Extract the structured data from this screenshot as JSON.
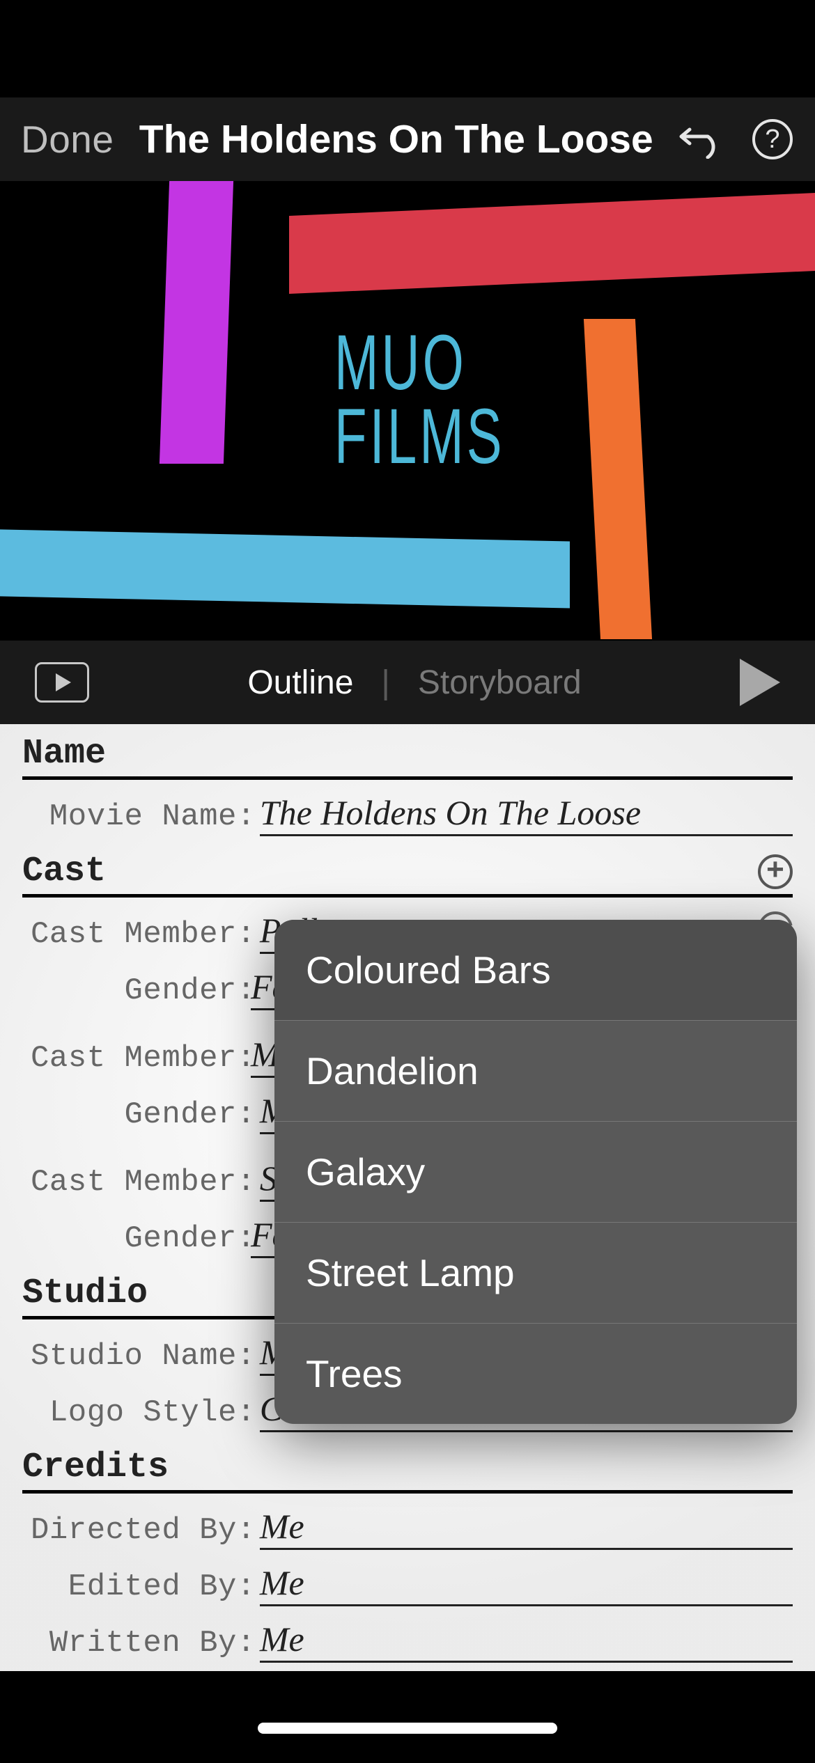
{
  "nav": {
    "done": "Done",
    "title": "The Holdens On The Loose"
  },
  "logo": {
    "line1": "MUO",
    "line2": "FILMS"
  },
  "tabs": {
    "outline": "Outline",
    "storyboard": "Storyboard"
  },
  "sections": {
    "name": "Name",
    "cast": "Cast",
    "studio": "Studio",
    "credits": "Credits"
  },
  "labels": {
    "movie_name": " Movie Name:",
    "cast_member": "Cast Member:",
    "gender": "     Gender:",
    "studio_name": "Studio Name:",
    "logo_style": " Logo Style:",
    "directed_by": "Directed By:",
    "edited_by": "  Edited By:",
    "written_by": " Written By:"
  },
  "values": {
    "movie_name": "The Holdens On The Loose",
    "cast1_name": "Polly",
    "cast1_gender": "Female",
    "cast2_name": "Matt",
    "cast2_gender": "Male",
    "cast3_name": "Sadie",
    "cast3_gender": "Female",
    "studio_name": "MUO",
    "logo_style": "Coloured Bars",
    "directed_by": "Me",
    "edited_by": "Me",
    "written_by": "Me"
  },
  "popup": {
    "opt1": "Coloured Bars",
    "opt2": "Dandelion",
    "opt3": "Galaxy",
    "opt4": "Street Lamp",
    "opt5": "Trees"
  }
}
